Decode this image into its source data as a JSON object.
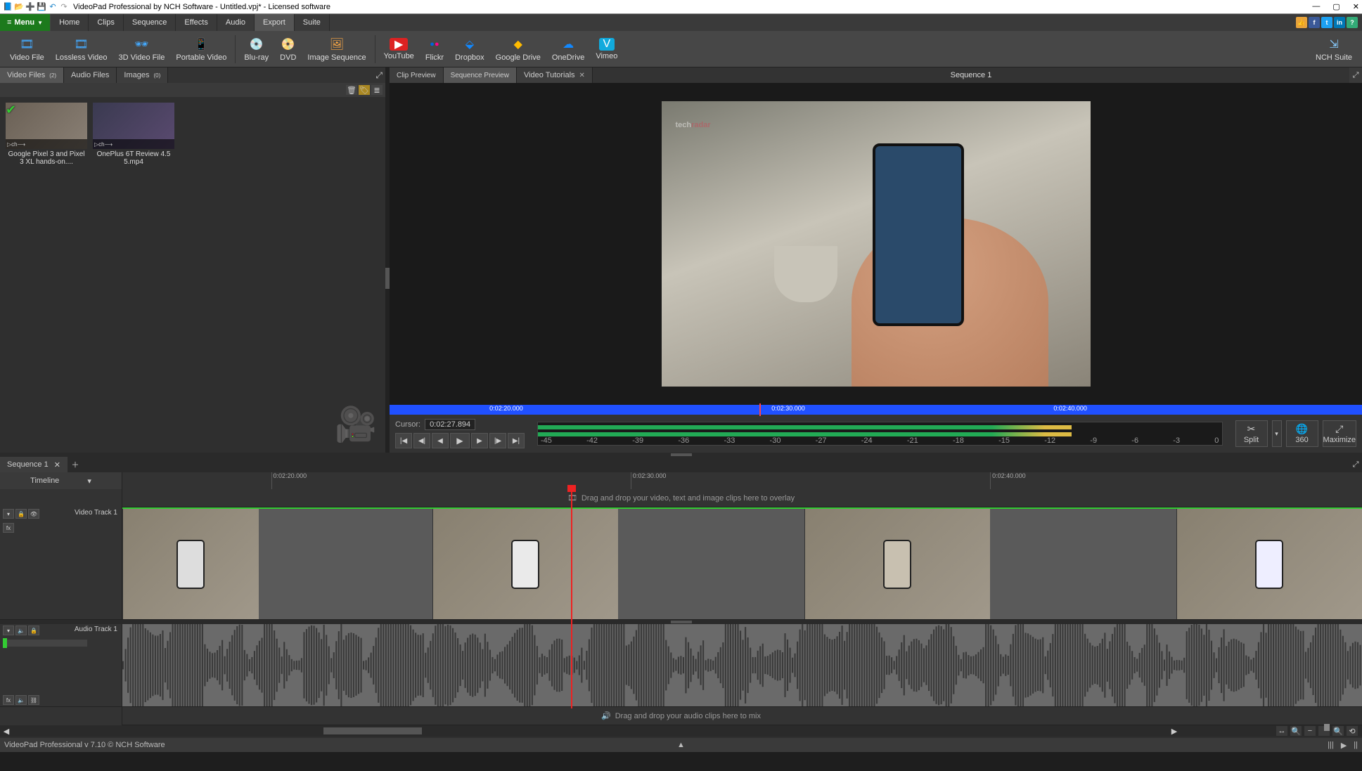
{
  "titlebar": {
    "app_title": "VideoPad Professional by NCH Software - Untitled.vpj* - Licensed software",
    "min": "—",
    "max": "▢",
    "close": "✕"
  },
  "menu": {
    "button": "Menu",
    "items": [
      "Home",
      "Clips",
      "Sequence",
      "Effects",
      "Audio",
      "Export",
      "Suite"
    ],
    "active": "Export"
  },
  "ribbon": {
    "group1": [
      {
        "icon": "🎞",
        "label": "Video File"
      },
      {
        "icon": "🎞",
        "label": "Lossless Video"
      },
      {
        "icon": "🕶",
        "label": "3D Video File"
      },
      {
        "icon": "📱",
        "label": "Portable Video"
      }
    ],
    "group2": [
      {
        "icon": "💿",
        "label": "Blu-ray"
      },
      {
        "icon": "📀",
        "label": "DVD"
      },
      {
        "icon": "🖼",
        "label": "Image Sequence"
      }
    ],
    "group3": [
      {
        "icon": "▶",
        "label": "YouTube",
        "color": "#d22"
      },
      {
        "icon": "●●",
        "label": "Flickr",
        "color": "#f08"
      },
      {
        "icon": "⬇",
        "label": "Dropbox",
        "color": "#18f"
      },
      {
        "icon": "▲",
        "label": "Google Drive",
        "color": "#2a4"
      },
      {
        "icon": "☁",
        "label": "OneDrive",
        "color": "#18f"
      },
      {
        "icon": "V",
        "label": "Vimeo",
        "color": "#1ad"
      }
    ],
    "right": {
      "icon": "⇲",
      "label": "NCH Suite"
    }
  },
  "bin_tabs": [
    {
      "label": "Video Files",
      "badge": "(2)",
      "active": true
    },
    {
      "label": "Audio Files",
      "badge": ""
    },
    {
      "label": "Images",
      "badge": "(0)"
    }
  ],
  "clips": [
    {
      "name": "Google Pixel 3 and Pixel 3 XL hands-on....",
      "check": true
    },
    {
      "name": "OnePlus 6T Review 4.5 5.mp4",
      "check": false
    }
  ],
  "preview_tabs": [
    {
      "label": "Clip Preview",
      "active": false
    },
    {
      "label": "Sequence Preview",
      "active": true
    },
    {
      "label": "Video Tutorials",
      "close": true
    }
  ],
  "preview_title": "Sequence 1",
  "watermark": {
    "a": "tech",
    "b": "radar"
  },
  "scrub_labels": [
    "0:02:20.000",
    "0:02:30.000",
    "0:02:40.000"
  ],
  "transport": {
    "cursor_label": "Cursor:",
    "cursor_value": "0:02:27.894",
    "vu_scale": [
      "-45",
      "-42",
      "-39",
      "-36",
      "-33",
      "-30",
      "-27",
      "-24",
      "-21",
      "-18",
      "-15",
      "-12",
      "-9",
      "-6",
      "-3",
      "0"
    ],
    "split": "Split",
    "r360": "360",
    "maximize": "Maximize"
  },
  "seq_tab": "Sequence 1",
  "timeline_mode": "Timeline",
  "ruler_labels": [
    "0:02:20.000",
    "0:02:30.000",
    "0:02:40.000"
  ],
  "overlay_hint": "Drag and drop your video, text and image clips here to overlay",
  "mix_hint": "Drag and drop your audio clips here to mix",
  "tracks": {
    "video": "Video Track 1",
    "audio": "Audio Track 1"
  },
  "status": {
    "text": "VideoPad Professional v 7.10 © NCH Software"
  }
}
